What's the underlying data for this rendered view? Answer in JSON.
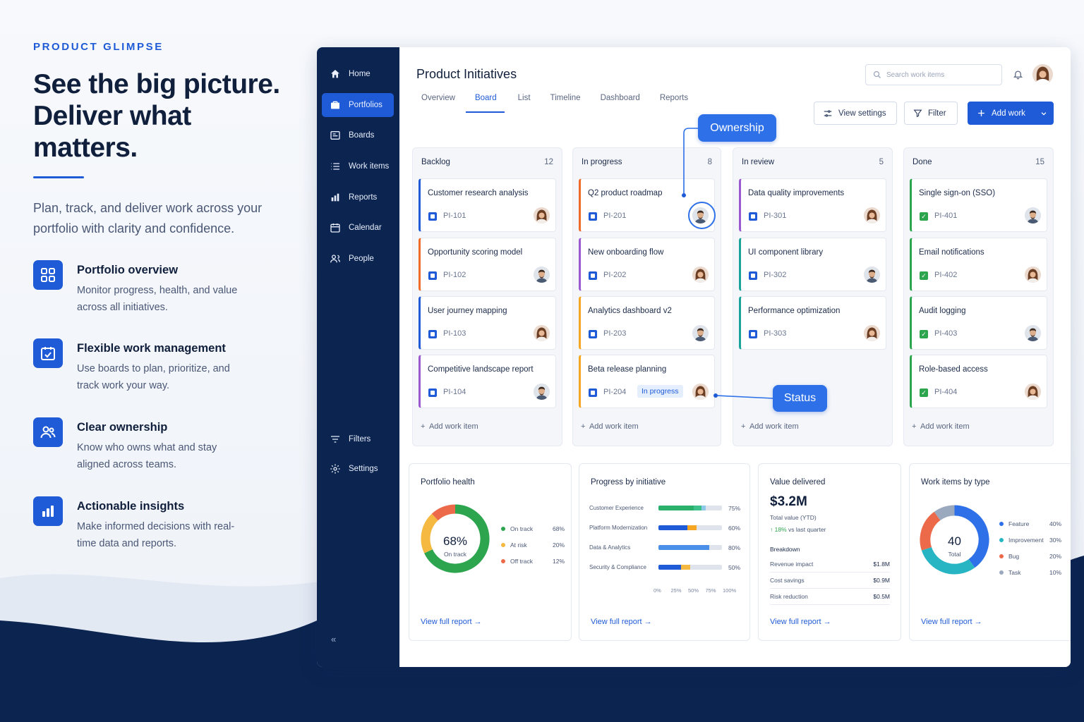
{
  "marketing": {
    "eyebrow": "PRODUCT GLIMPSE",
    "headline_1": "See the big picture.",
    "headline_2": "Deliver what matters.",
    "lede": "Plan, track, and deliver work across your portfolio with clarity and confidence.",
    "features": [
      {
        "title": "Portfolio overview",
        "body": "Monitor progress, health, and value across all initiatives.",
        "icon": "grid-icon"
      },
      {
        "title": "Flexible work management",
        "body": "Use boards to plan, prioritize, and track work your way.",
        "icon": "calendar-check-icon"
      },
      {
        "title": "Clear ownership",
        "body": "Know who owns what and stay aligned across teams.",
        "icon": "people-icon"
      },
      {
        "title": "Actionable insights",
        "body": "Make informed decisions with real-time data and reports.",
        "icon": "bar-chart-icon"
      }
    ]
  },
  "sidebar": {
    "items": [
      {
        "label": "Home",
        "icon": "home-icon"
      },
      {
        "label": "Portfolios",
        "icon": "briefcase-icon",
        "active": true
      },
      {
        "label": "Boards",
        "icon": "board-icon"
      },
      {
        "label": "Work items",
        "icon": "list-icon"
      },
      {
        "label": "Reports",
        "icon": "bar-chart-icon"
      },
      {
        "label": "Calendar",
        "icon": "calendar-icon"
      },
      {
        "label": "People",
        "icon": "people-icon"
      }
    ],
    "bottom": [
      {
        "label": "Filters",
        "icon": "filter-icon"
      },
      {
        "label": "Settings",
        "icon": "gear-icon"
      }
    ],
    "collapse": "«"
  },
  "header": {
    "title": "Product Initiatives",
    "tabs": [
      "Overview",
      "Board",
      "List",
      "Timeline",
      "Dashboard",
      "Reports"
    ],
    "active_tab": "Board",
    "search_placeholder": "Search work items",
    "view_settings": "View settings",
    "filter": "Filter",
    "add_work": "Add work"
  },
  "callouts": {
    "ownership": "Ownership",
    "status": "Status"
  },
  "board": {
    "add_label": "Add work item",
    "columns": [
      {
        "name": "Backlog",
        "count": "12",
        "accent": "",
        "cards": [
          {
            "title": "Customer research analysis",
            "id": "PI-101",
            "bar": "#1f5bd6"
          },
          {
            "title": "Opportunity scoring model",
            "id": "PI-102",
            "bar": "#f06a2a"
          },
          {
            "title": "User journey mapping",
            "id": "PI-103",
            "bar": "#1f5bd6"
          },
          {
            "title": "Competitive landscape report",
            "id": "PI-104",
            "bar": "#9b59d0"
          }
        ]
      },
      {
        "name": "In progress",
        "count": "8",
        "cards": [
          {
            "title": "Q2 product roadmap",
            "id": "PI-201",
            "bar": "#f06a2a"
          },
          {
            "title": "New onboarding flow",
            "id": "PI-202",
            "bar": "#9b59d0"
          },
          {
            "title": "Analytics dashboard v2",
            "id": "PI-203",
            "bar": "#f5a623"
          },
          {
            "title": "Beta release planning",
            "id": "PI-204",
            "bar": "#f5a623",
            "pill": "In progress"
          }
        ]
      },
      {
        "name": "In review",
        "count": "5",
        "cards": [
          {
            "title": "Data quality improvements",
            "id": "PI-301",
            "bar": "#9b59d0"
          },
          {
            "title": "UI component library",
            "id": "PI-302",
            "bar": "#1aa39a"
          },
          {
            "title": "Performance optimization",
            "id": "PI-303",
            "bar": "#1aa39a"
          }
        ]
      },
      {
        "name": "Done",
        "count": "15",
        "cards": [
          {
            "title": "Single sign-on (SSO)",
            "id": "PI-401",
            "bar": "#2da44e"
          },
          {
            "title": "Email notifications",
            "id": "PI-402",
            "bar": "#2da44e"
          },
          {
            "title": "Audit logging",
            "id": "PI-403",
            "bar": "#2da44e"
          },
          {
            "title": "Role-based access",
            "id": "PI-404",
            "bar": "#2da44e"
          }
        ]
      }
    ]
  },
  "panels": {
    "view_full": "View full report",
    "health": {
      "title": "Portfolio health",
      "center": "68%",
      "center_label": "On track",
      "legend": [
        {
          "label": "On track",
          "value": "68%",
          "color": "#2da44e",
          "fraction": 0.68
        },
        {
          "label": "At risk",
          "value": "20%",
          "color": "#f5b942",
          "fraction": 0.2
        },
        {
          "label": "Off track",
          "value": "12%",
          "color": "#ec6a4a",
          "fraction": 0.12
        }
      ]
    },
    "progress": {
      "title": "Progress by initiative",
      "rows": [
        {
          "label": "Customer Experience",
          "value": "75%",
          "segments": [
            0.55,
            0.13,
            0.07
          ],
          "colors": [
            "#2ab06a",
            "#3ec08a",
            "#8fc9e8"
          ]
        },
        {
          "label": "Platform Modernization",
          "value": "60%",
          "segments": [
            0.45,
            0.15
          ],
          "colors": [
            "#1f5bd6",
            "#f5a623"
          ]
        },
        {
          "label": "Data & Analytics",
          "value": "80%",
          "segments": [
            0.8
          ],
          "colors": [
            "#4a90e8"
          ]
        },
        {
          "label": "Security & Compliance",
          "value": "50%",
          "segments": [
            0.35,
            0.15
          ],
          "colors": [
            "#1f5bd6",
            "#f5b942"
          ]
        }
      ],
      "axis": [
        "0%",
        "25%",
        "50%",
        "75%",
        "100%"
      ]
    },
    "value": {
      "title": "Value delivered",
      "amount": "$3.2M",
      "sub": "Total value (YTD)",
      "delta": "18%",
      "delta_label": "vs last quarter",
      "breakdown_title": "Breakdown",
      "rows": [
        {
          "label": "Revenue impact",
          "value": "$1.8M"
        },
        {
          "label": "Cost savings",
          "value": "$0.9M"
        },
        {
          "label": "Risk reduction",
          "value": "$0.5M"
        }
      ]
    },
    "types": {
      "title": "Work items by type",
      "center": "40",
      "center_label": "Total",
      "legend": [
        {
          "label": "Feature",
          "value": "40%",
          "color": "#2d70e8",
          "fraction": 0.4
        },
        {
          "label": "Improvement",
          "value": "30%",
          "color": "#27b5c4",
          "fraction": 0.3
        },
        {
          "label": "Bug",
          "value": "20%",
          "color": "#ec6a4a",
          "fraction": 0.2
        },
        {
          "label": "Task",
          "value": "10%",
          "color": "#9aa9bd",
          "fraction": 0.1
        }
      ]
    }
  }
}
